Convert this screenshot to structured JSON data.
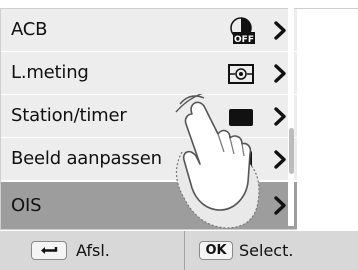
{
  "menu": {
    "items": [
      {
        "label": "ACB",
        "icon": "acb-off-icon"
      },
      {
        "label": "L.meting",
        "icon": "metering-icon"
      },
      {
        "label": "Station/timer",
        "icon": "drive-mode-icon"
      },
      {
        "label": "Beeld aanpassen",
        "icon": "image-adjust-icon"
      },
      {
        "label": "OIS",
        "icon": "ois-icon"
      }
    ],
    "selected_index": 4
  },
  "bottom_bar": {
    "back_label": "Afsl.",
    "ok_key": "OK",
    "select_label": "Select."
  },
  "colors": {
    "row_background": "#ededed",
    "selected_row_background": "#9d9d9d",
    "bottom_bar_background": "#d8d8d8"
  }
}
